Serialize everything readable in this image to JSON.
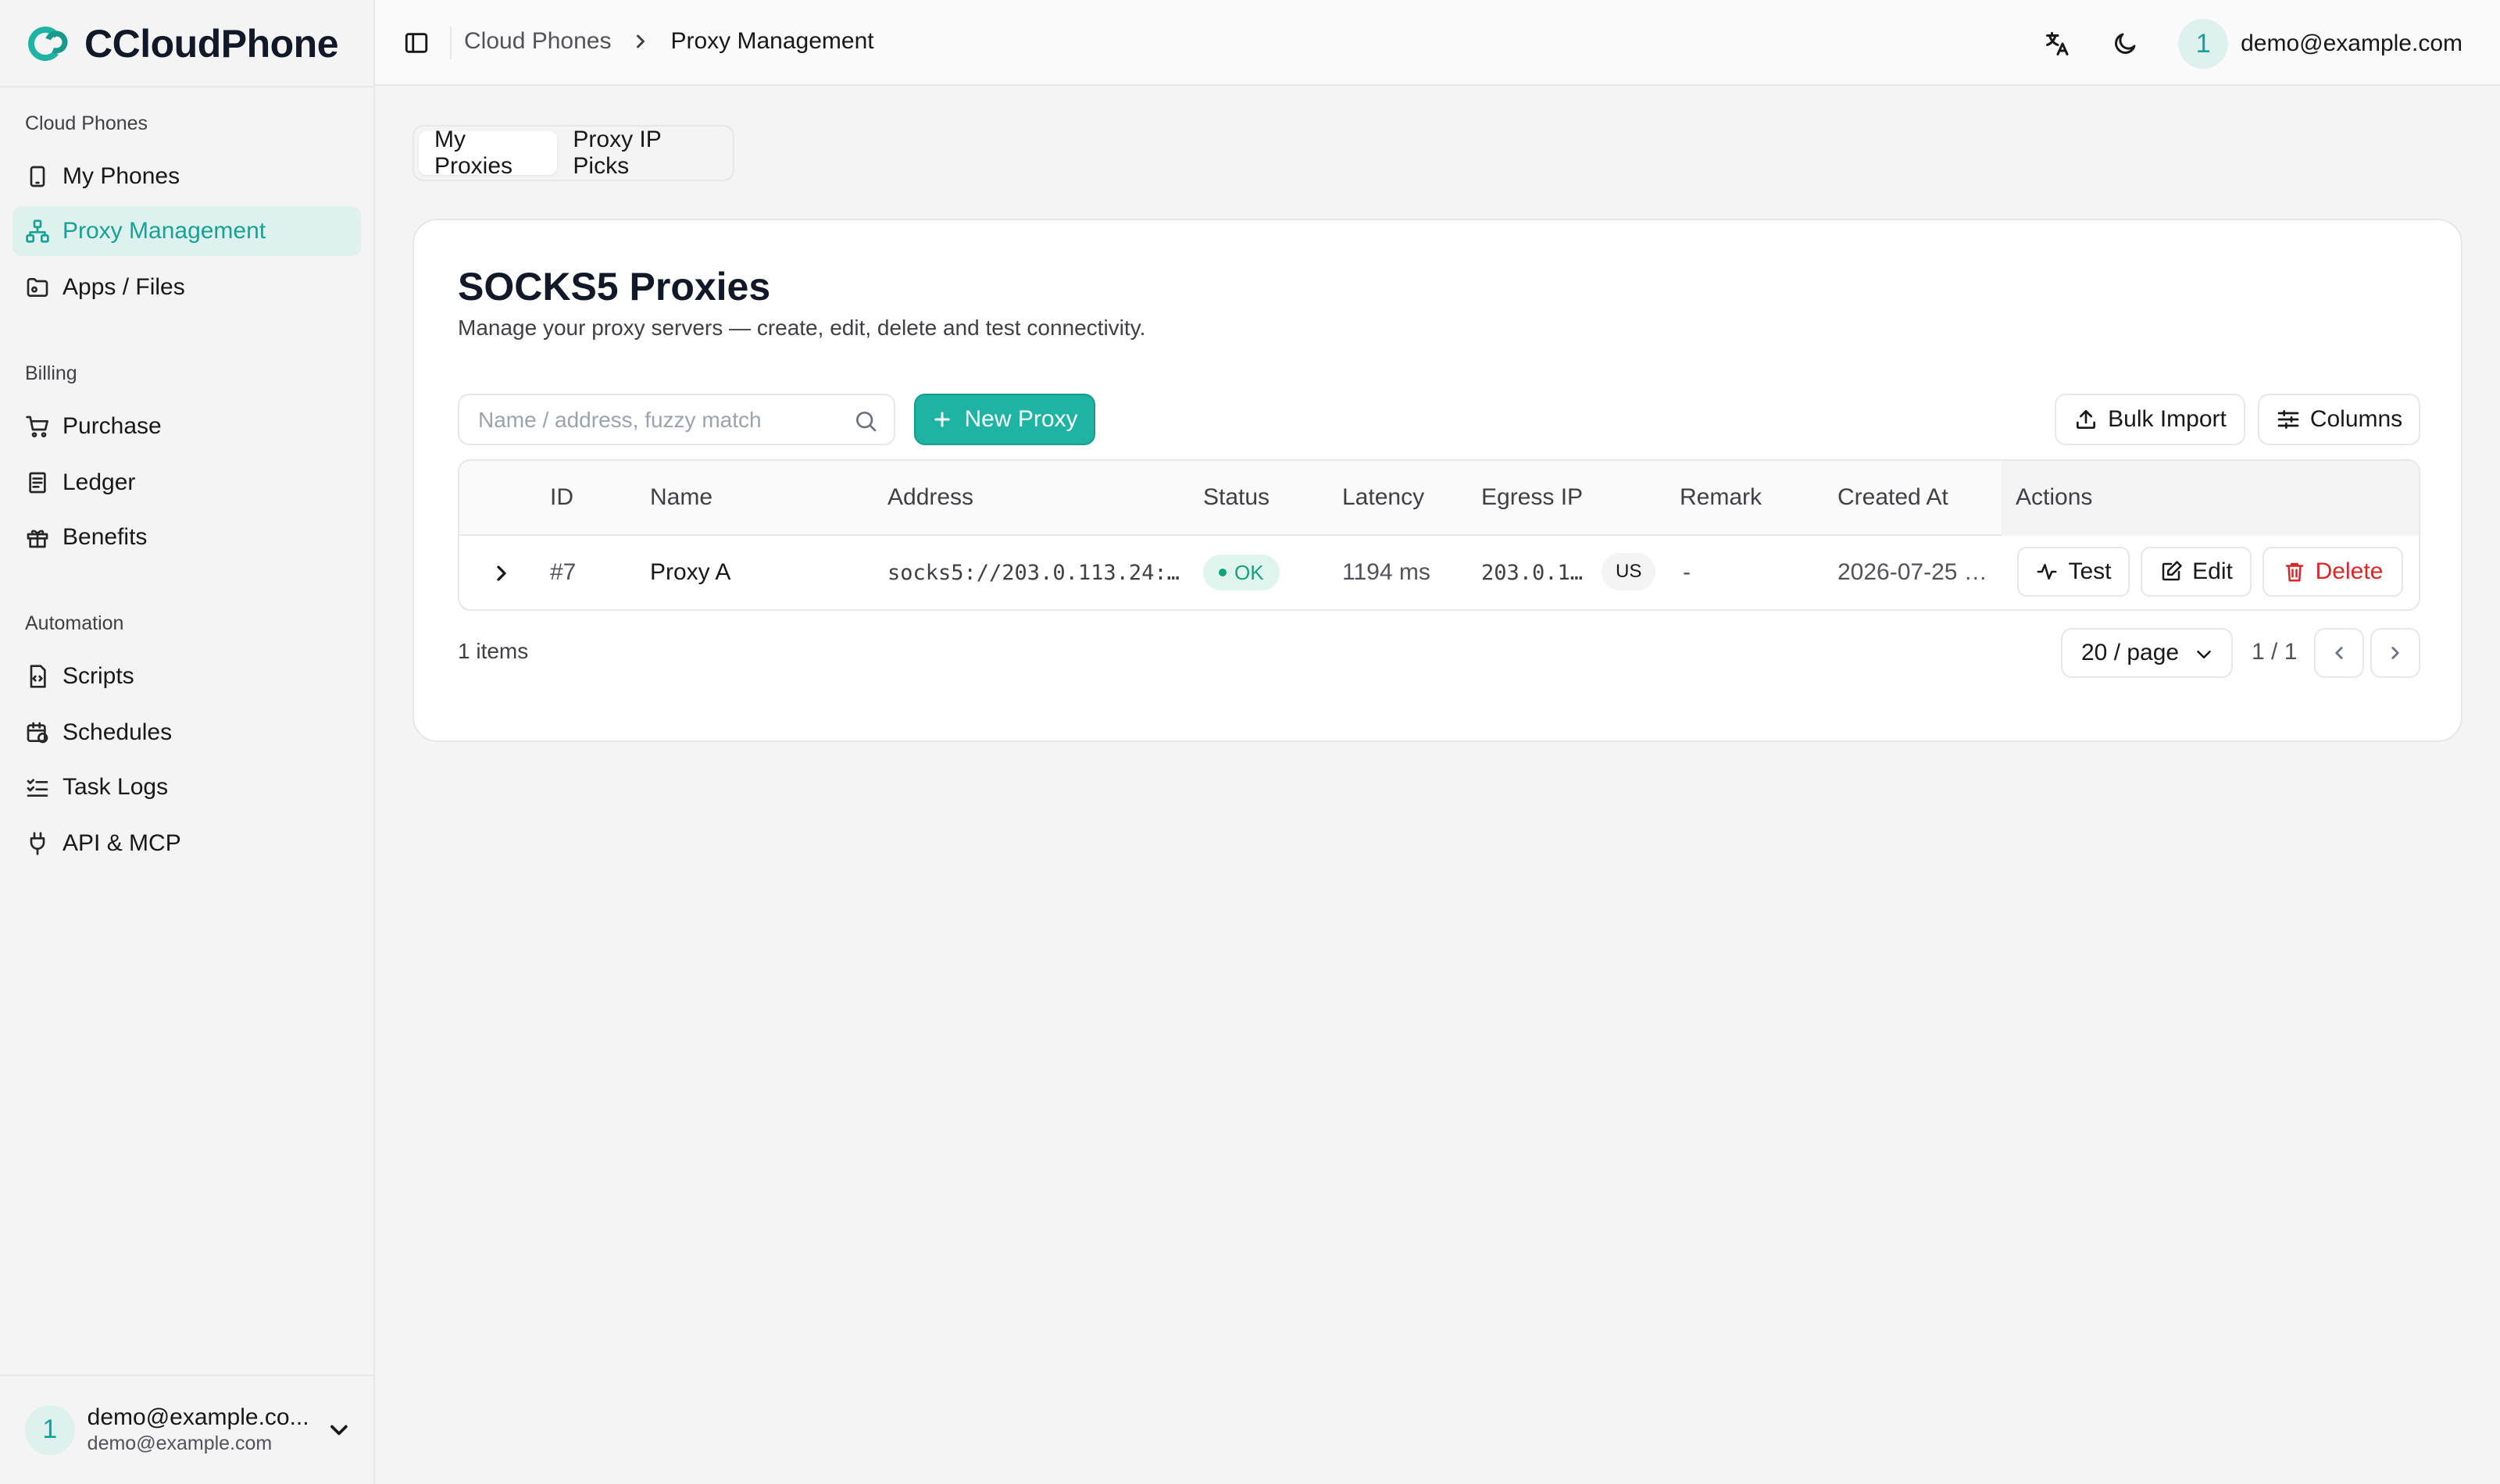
{
  "app": {
    "name": "CCloudPhone",
    "accent": "#1fb3a3"
  },
  "sidebar": {
    "groups": [
      {
        "title": "Cloud Phones",
        "items": [
          {
            "label": "My Phones",
            "icon": "phone-icon"
          },
          {
            "label": "Proxy Management",
            "icon": "network-icon",
            "active": true
          },
          {
            "label": "Apps / Files",
            "icon": "folder-icon"
          }
        ]
      },
      {
        "title": "Billing",
        "items": [
          {
            "label": "Purchase",
            "icon": "cart-icon"
          },
          {
            "label": "Ledger",
            "icon": "ledger-icon"
          },
          {
            "label": "Benefits",
            "icon": "gift-icon"
          }
        ]
      },
      {
        "title": "Automation",
        "items": [
          {
            "label": "Scripts",
            "icon": "script-icon"
          },
          {
            "label": "Schedules",
            "icon": "calendar-clock-icon"
          },
          {
            "label": "Task Logs",
            "icon": "list-checks-icon"
          },
          {
            "label": "API & MCP",
            "icon": "plug-icon"
          }
        ]
      }
    ],
    "user": {
      "avatar": "1",
      "name": "demo@example.co...",
      "email": "demo@example.com"
    }
  },
  "topbar": {
    "breadcrumb": [
      "Cloud Phones",
      "Proxy Management"
    ],
    "avatar": "1",
    "email": "demo@example.com"
  },
  "tabs": [
    "My Proxies",
    "Proxy IP Picks"
  ],
  "card": {
    "title": "SOCKS5 Proxies",
    "subtitle": "Manage your proxy servers — create, edit, delete and test connectivity.",
    "search_placeholder": "Name / address, fuzzy match",
    "new_button": "New Proxy",
    "bulk_import": "Bulk Import",
    "columns_button": "Columns"
  },
  "table": {
    "headers": [
      "ID",
      "Name",
      "Address",
      "Status",
      "Latency",
      "Egress IP",
      "Remark",
      "Created At",
      "Actions"
    ],
    "rows": [
      {
        "id": "#7",
        "name": "Proxy A",
        "address": "socks5://203.0.113.24:…",
        "status": "OK",
        "latency": "1194 ms",
        "egress_ip": "203.0.1…",
        "country": "US",
        "remark": "-",
        "created_at": "2026-07-25 …",
        "actions": [
          "Test",
          "Edit",
          "Delete"
        ]
      }
    ]
  },
  "footer": {
    "items_count": "1 items",
    "page_size": "20 / page",
    "page_indicator": "1 / 1"
  }
}
